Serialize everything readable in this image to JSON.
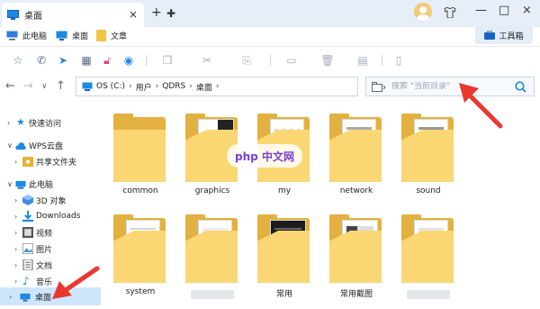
{
  "window": {
    "tab_title": "桌面",
    "tab_close": "×",
    "new_tab": "+",
    "new_tab_alt": "✚",
    "minimize": "—",
    "restore": "□",
    "close": "×",
    "wardrobe_icon": "shirt-icon"
  },
  "bookmarks": {
    "items": [
      {
        "label": "此电脑",
        "icon": "computer-icon"
      },
      {
        "label": "桌面",
        "icon": "desktop-icon"
      },
      {
        "label": "文章",
        "icon": "folder-icon"
      }
    ],
    "toolbox_label": "工具箱"
  },
  "toolbar": {
    "icons": [
      "star-icon",
      "chat-icon",
      "send-icon",
      "split-view-icon",
      "unlock-icon",
      "eye-icon",
      "copy-icon",
      "cut-icon",
      "paste-icon",
      "delete-icon",
      "rename-icon",
      "properties-icon"
    ]
  },
  "address": {
    "segments": [
      "OS (C:)",
      "用户",
      "QDRS",
      "桌面"
    ],
    "search_placeholder": "搜索 \"当前目录\""
  },
  "sidebar": {
    "items": [
      {
        "label": "快速访问",
        "icon": "star-icon",
        "color": "#1e88e5"
      },
      {
        "label": "WPS云盘",
        "icon": "cloud-icon",
        "color": "#1e88e5"
      },
      {
        "label": "共享文件夹",
        "icon": "shared-folder-icon",
        "color": "#e6b02f"
      },
      {
        "label": "此电脑",
        "icon": "computer-icon",
        "color": "#1e88e5"
      },
      {
        "label": "3D 对象",
        "icon": "cube-icon",
        "color": "#3c8ee0"
      },
      {
        "label": "Downloads",
        "icon": "download-icon",
        "color": "#1e88e5"
      },
      {
        "label": "视频",
        "icon": "video-icon",
        "color": "#555"
      },
      {
        "label": "图片",
        "icon": "image-icon",
        "color": "#555"
      },
      {
        "label": "文档",
        "icon": "document-icon",
        "color": "#555"
      },
      {
        "label": "音乐",
        "icon": "music-icon",
        "color": "#1e88e5"
      },
      {
        "label": "桌面",
        "icon": "desktop-icon",
        "color": "#1e88e5"
      }
    ],
    "selected_label": "桌面"
  },
  "files": {
    "row1": [
      "common",
      "graphics",
      "my",
      "network",
      "sound"
    ],
    "row2": [
      "system",
      "",
      "常用",
      "常用截图",
      ""
    ]
  },
  "watermark": "php 中文网",
  "colors": {
    "accent": "#1e88e5",
    "folder": "#fbd773",
    "arrow": "#e8382f",
    "selection": "#cde6fb"
  }
}
